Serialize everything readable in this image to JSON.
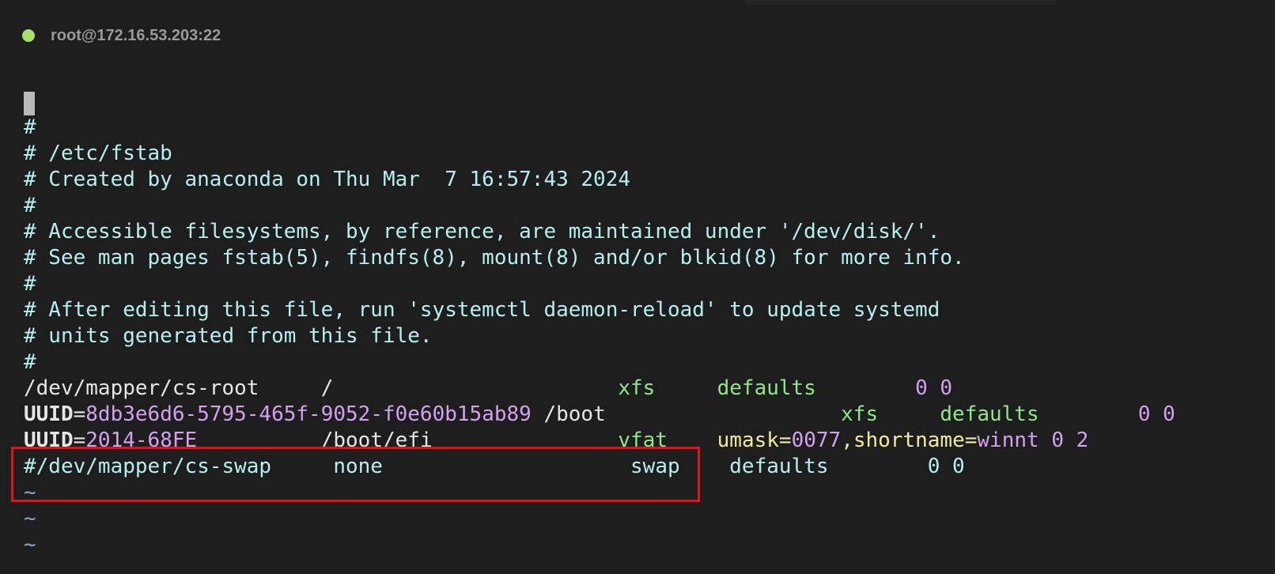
{
  "window": {
    "status_color": "#a6e16a",
    "title": "root@172.16.53.203:22"
  },
  "editor": {
    "comments": {
      "c1": "#",
      "c2": "# /etc/fstab",
      "c3": "# Created by anaconda on Thu Mar  7 16:57:43 2024",
      "c4": "#",
      "c5": "# Accessible filesystems, by reference, are maintained under '/dev/disk/'.",
      "c6": "# See man pages fstab(5), findfs(8), mount(8) and/or blkid(8) for more info.",
      "c7": "#",
      "c8": "# After editing this file, run 'systemctl daemon-reload' to update systemd",
      "c9": "# units generated from this file.",
      "c10": "#"
    },
    "entries": {
      "root": {
        "device": "/dev/mapper/cs-root     ",
        "mount": "/                       ",
        "fstype": "xfs     ",
        "options": "defaults        ",
        "dump_pass": "0 0"
      },
      "boot": {
        "uuid_key": "UUID",
        "eq": "=",
        "uuid_val": "8db3e6d6-5795-465f-9052-f0e60b15ab89",
        "mount": " /boot                   ",
        "fstype": "xfs     ",
        "options": "defaults        ",
        "dump_pass": "0 0"
      },
      "efi": {
        "uuid_key": "UUID",
        "eq": "=",
        "uuid_val": "2014-68FE",
        "gap": "          ",
        "mount": "/boot/efi               ",
        "fstype": "vfat    ",
        "opt_umask": "umask=",
        "opt_umask_val": "0077",
        "opt_sep": ",",
        "opt_short": "shortname=",
        "opt_short_val": "winnt",
        "dump_pass": " 0 2"
      },
      "swap": {
        "device": "#/dev/mapper/cs-swap     ",
        "mount": "none                    ",
        "fstype": "swap    ",
        "options": "defaults        ",
        "dump_pass": "0 0"
      }
    },
    "tildes": [
      "~",
      "~",
      "~"
    ]
  },
  "highlight": {
    "color": "#e0141e"
  }
}
